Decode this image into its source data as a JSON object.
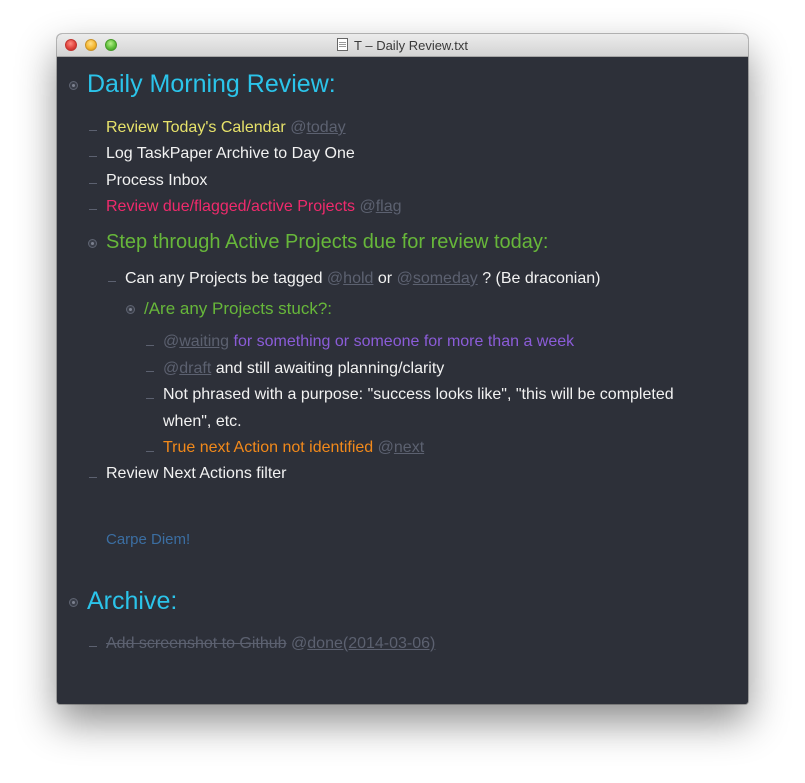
{
  "window": {
    "title": "T – Daily Review.txt"
  },
  "projects": {
    "daily": "Daily Morning Review:",
    "archive": "Archive:"
  },
  "tasks": {
    "calendar": {
      "text": "Review Today's Calendar",
      "tag_at": "@",
      "tag": "today"
    },
    "log": "Log TaskPaper Archive to Day One",
    "inbox": "Process Inbox",
    "due": {
      "text": "Review due/flagged/active Projects",
      "tag_at": "@",
      "tag": "flag"
    },
    "step": "Step through Active Projects due for review today:",
    "can_any": {
      "pre": "Can any Projects be tagged",
      "tag1": "hold",
      "mid": "or",
      "tag2": "someday",
      "post": "? (Be draconian)"
    },
    "stuck": "/Are any Projects stuck?:",
    "waiting": {
      "tag": "waiting",
      "text": "for something or someone for more than a week"
    },
    "draft": {
      "tag": "draft",
      "text": "and still awaiting planning/clarity"
    },
    "purpose_line1": "Not phrased with a purpose: \"success looks like\", \"this will be completed",
    "purpose_line2": "when\", etc.",
    "next_action": {
      "text": "True next Action not identified",
      "tag": "next"
    },
    "review_next": "Review Next Actions filter",
    "carpe": "Carpe Diem!",
    "screenshot": {
      "text": "Add screenshot to Github",
      "tag": "done(2014-03-06)"
    }
  },
  "tag_prefix": "@",
  "colors": {
    "background": "#2d3039",
    "project_heading": "#2bc4ea",
    "subproject": "#67b73a",
    "today": "#e7e26a",
    "flag": "#ef2a6c",
    "waiting": "#8b5cd8",
    "next": "#f2891a",
    "note": "#3b6ea2",
    "tag": "#5c6170"
  }
}
